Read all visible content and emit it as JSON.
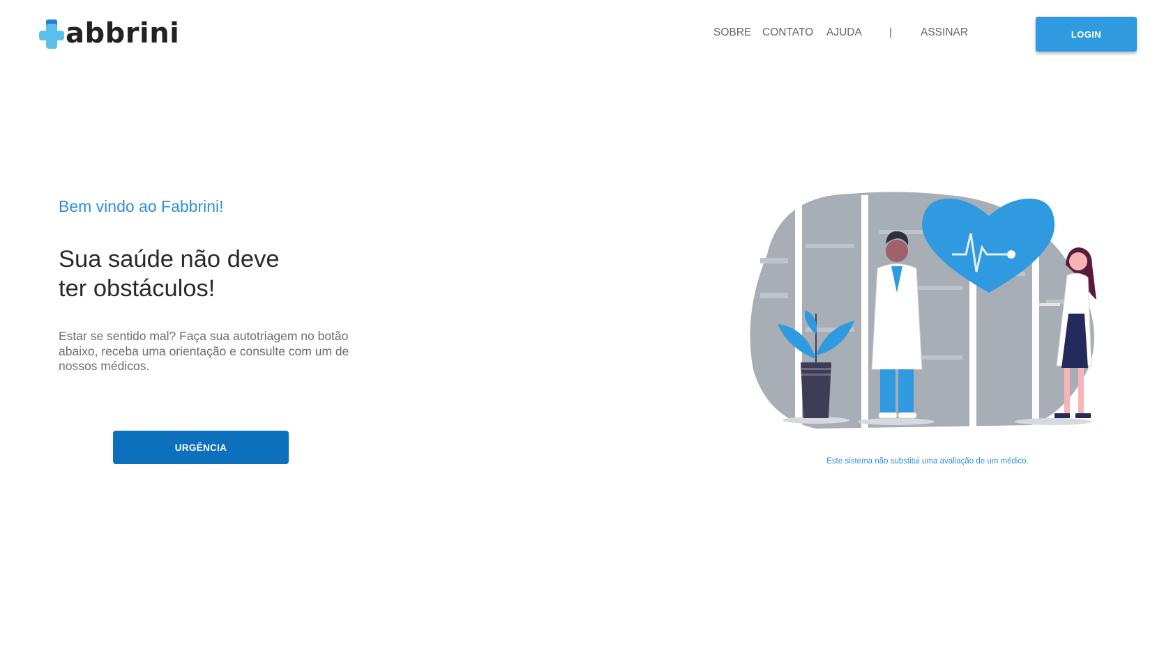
{
  "header": {
    "logo_text": "abbrini",
    "nav": [
      {
        "label": "SOBRE"
      },
      {
        "label": "CONTATO"
      },
      {
        "label": "AJUDA"
      },
      {
        "label": "|"
      },
      {
        "label": "ASSINAR"
      }
    ],
    "login_label": "LOGIN"
  },
  "hero": {
    "welcome": "Bem vindo ao Fabbrini!",
    "headline_line1": "Sua saúde não deve",
    "headline_line2": "ter obstáculos!",
    "description": "Estar se sentido mal? Faça sua autotriagem no botão abaixo, receba uma orientação e consulte com um de nossos médicos.",
    "urgency_label": "URGÊNCIA"
  },
  "illustration": {
    "disclaimer": "Este sistema não substitui uma avaliação de um médico."
  },
  "colors": {
    "brand_blue": "#2f9ae0",
    "primary_button": "#0c70bd",
    "accent_text": "#2f8fd8",
    "logo_dark_blue": "#1f7fd0",
    "logo_light_blue": "#5dc0ec"
  },
  "icons": {
    "logo": "medical-cross-icon",
    "illustration_heart": "heart-pulse-icon"
  }
}
